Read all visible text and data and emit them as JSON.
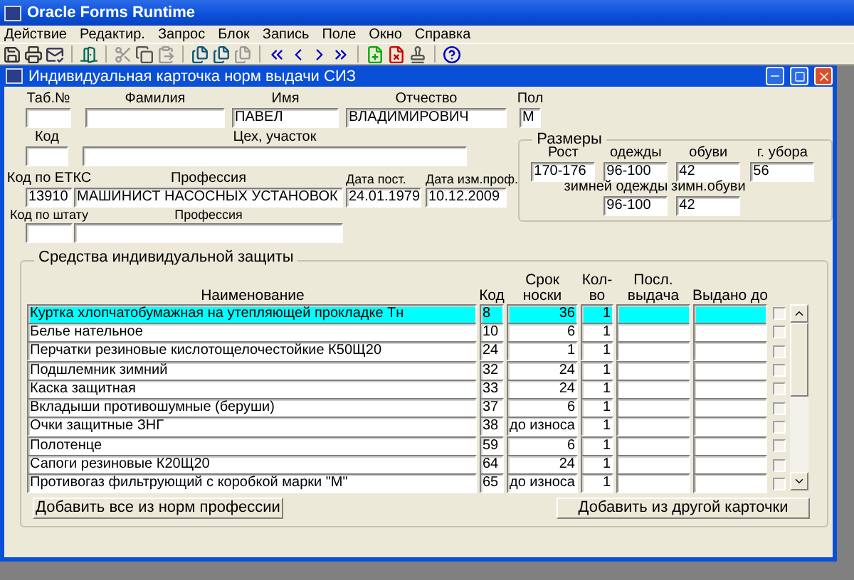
{
  "app_title": "Oracle Forms Runtime",
  "menu": [
    "Действие",
    "Редактир.",
    "Запрос",
    "Блок",
    "Запись",
    "Поле",
    "Окно",
    "Справка"
  ],
  "window": {
    "title": "Индивидуальная карточка норм выдачи СИЗ"
  },
  "form_rows": [
    {
      "fields": [
        {
          "label": "Таб.№"
        },
        {
          "label": "Фамилия"
        },
        {
          "label": "Имя",
          "value": "ПАВЕЛ"
        },
        {
          "label": "Отчество",
          "value": "ВЛАДИМИРОВИЧ"
        },
        {
          "label": "Пол",
          "value": "М"
        }
      ]
    },
    {
      "fields": [
        {
          "label": "Код"
        },
        {
          "label": "Цех, участок"
        }
      ]
    },
    {
      "fields": [
        {
          "label": "Код по ЕТКС",
          "value": "13910"
        },
        {
          "label": "Профессия",
          "value": "МАШИНИСТ НАСОСНЫХ УСТАНОВОК"
        },
        {
          "label": "Дата пост.",
          "value": "24.01.1979"
        },
        {
          "label": "Дата изм.проф.",
          "value": "10.12.2009"
        }
      ]
    },
    {
      "fields": [
        {
          "label": "Код по штату"
        },
        {
          "label": "Профессия"
        }
      ]
    }
  ],
  "sizes": {
    "title": "Размеры",
    "fields": [
      {
        "label": "Рост",
        "value": "170-176"
      },
      {
        "label": "одежды",
        "value": "96-100"
      },
      {
        "label": "обуви",
        "value": "42"
      },
      {
        "label": "г. убора",
        "value": "56"
      },
      {
        "label": "зимней одежды",
        "value": "96-100"
      },
      {
        "label": "зимн.обуви",
        "value": "42"
      }
    ]
  },
  "ppe": {
    "title": "Средства индивидуальной защиты",
    "columns": [
      "Наименование",
      "Код",
      "Срок носки",
      "Кол-во",
      "Посл. выдача",
      "Выдано до"
    ],
    "rows": [
      {
        "name": "Куртка хлопчатобумажная на утепляющей прокладке Тн",
        "code": "8",
        "term": "36",
        "qty": "1",
        "selected": true,
        "checked": false
      },
      {
        "name": "Белье нательное",
        "code": "10",
        "term": "6",
        "qty": "1",
        "selected": false,
        "checked": false
      },
      {
        "name": "Перчатки резиновые кислотощелочестойкие К50Щ20",
        "code": "24",
        "term": "1",
        "qty": "1",
        "selected": false,
        "checked": false
      },
      {
        "name": "Подшлемник зимний",
        "code": "32",
        "term": "24",
        "qty": "1",
        "selected": false,
        "checked": false
      },
      {
        "name": "Каска защитная",
        "code": "33",
        "term": "24",
        "qty": "1",
        "selected": false,
        "checked": false
      },
      {
        "name": "Вкладыши противошумные (беруши)",
        "code": "37",
        "term": "6",
        "qty": "1",
        "selected": false,
        "checked": false
      },
      {
        "name": "Очки защитные ЗНГ",
        "code": "38",
        "term": "до износа",
        "qty": "1",
        "selected": false,
        "checked": false
      },
      {
        "name": "Полотенце",
        "code": "59",
        "term": "6",
        "qty": "1",
        "selected": false,
        "checked": false
      },
      {
        "name": "Сапоги резиновые К20Щ20",
        "code": "64",
        "term": "24",
        "qty": "1",
        "selected": false,
        "checked": false
      },
      {
        "name": "Противогаз фильтрующий с коробкой марки \"М\"",
        "code": "65",
        "term": "до износа",
        "qty": "1",
        "selected": false,
        "checked": false
      }
    ],
    "buttons": [
      "Добавить все из норм профессии",
      "Добавить из другой карточки"
    ]
  }
}
